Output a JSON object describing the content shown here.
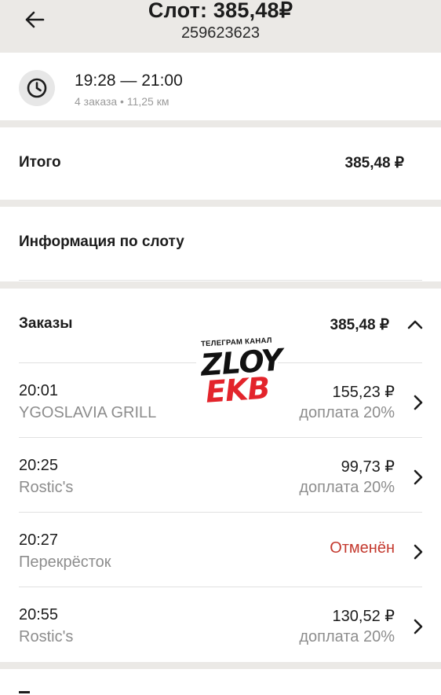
{
  "header": {
    "title": "Слот: 385,48₽",
    "subtitle": "259623623"
  },
  "slot": {
    "time_range": "19:28 — 21:00",
    "meta": "4 заказа • 11,25 км"
  },
  "total": {
    "label": "Итого",
    "value": "385,48 ₽"
  },
  "info": {
    "label": "Информация по слоту"
  },
  "orders_section": {
    "label": "Заказы",
    "value": "385,48 ₽",
    "orders": [
      {
        "time": "20:01",
        "name": "YGOSLAVIA GRILL",
        "price": "155,23 ₽",
        "note": "доплата 20%"
      },
      {
        "time": "20:25",
        "name": "Rostic's",
        "price": "99,73 ₽",
        "note": "доплата 20%"
      },
      {
        "time": "20:27",
        "name": "Перекрёсток",
        "status": "Отменён"
      },
      {
        "time": "20:55",
        "name": "Rostic's",
        "price": "130,52 ₽",
        "note": "доплата 20%"
      }
    ]
  },
  "watermark": {
    "line1": "ТЕЛЕГРАМ КАНАЛ",
    "line2": "ZLOY",
    "line3": "EKB"
  },
  "icons": {
    "back": "arrow-left-icon",
    "clock": "clock-icon",
    "collapse": "chevron-up-icon",
    "order": "chevron-right-icon"
  },
  "colors": {
    "canceled": "#c4392e",
    "background": "#ebe9e6",
    "watermark_red": "#e3242b"
  }
}
